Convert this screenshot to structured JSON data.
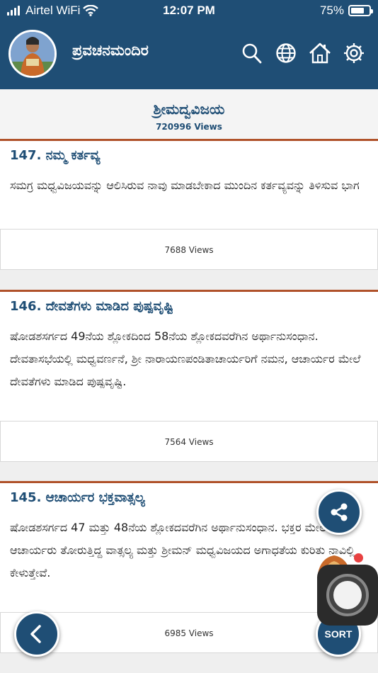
{
  "status_bar": {
    "carrier": "Airtel WiFi",
    "time": "12:07 PM",
    "battery": "75%",
    "battery_level": 0.75
  },
  "header": {
    "title": "ಪ್ರವಚನಮಂದಿರ"
  },
  "page": {
    "title": "ಶ್ರೀಮದ್ವವಿಜಯ",
    "views": "720996 Views"
  },
  "items": [
    {
      "title": "147. ನಮ್ಮ ಕರ್ತವ್ಯ",
      "desc": "ಸಮಗ್ರ ಮಧ್ವವಿಜಯವನ್ನು ಆಲಿಸಿರುವ ನಾವು ಮಾಡಬೇಕಾದ ಮುಂದಿನ ಕರ್ತವ್ಯವನ್ನು ತಿಳಿಸುವ ಭಾಗ",
      "views": "7688 Views"
    },
    {
      "title": "146. ದೇವತೆಗಳು ಮಾಡಿದ ಪುಷ್ಪವೃಷ್ಟಿ",
      "desc": "ಷೋಡಶಸರ್ಗದ 49ನೆಯ ಶ್ಲೋಕದಿಂದ 58ನೆಯ ಶ್ಲೋಕದವರೆಗಿನ ಅರ್ಥಾನುಸಂಧಾನ. ದೇವತಾಸಭೆಯಲ್ಲಿ ಮಧ್ವವರ್ಣನೆ, ಶ್ರೀ ನಾರಾಯಣಪಂಡಿತಾಚಾರ್ಯರಿಗೆ ನಮನ, ಆಚಾರ್ಯರ ಮೇಲೆ ದೇವತೆಗಳು ಮಾಡಿದ ಪುಷ್ಪವೃಷ್ಟಿ.",
      "views": "7564 Views"
    },
    {
      "title": "145. ಆಚಾರ್ಯರ ಭಕ್ತವಾತ್ಸಲ್ಯ",
      "desc": "ಷೋಡಶಸರ್ಗದ 47 ಮತ್ತು 48ನೆಯ ಶ್ಲೋಕದವರೆಗಿನ ಅರ್ಥಾನುಸಂಧಾನ. ಭಕ್ತರ ಮೇಲೆ ಆಚಾರ್ಯರು ತೋರುತ್ತಿದ್ದ ವಾತ್ಸಲ್ಯ ಮತ್ತು ಶ್ರೀಮನ್ ಮಧ್ವವಿಜಯದ ಅಗಾಧತೆಯ ಕುರಿತು ನಾವಿಲ್ಲಿ ಕೇಳುತ್ತೇವೆ.",
      "views": "6985 Views"
    }
  ],
  "controls": {
    "sort_label": "SORT"
  },
  "icons": [
    "search-icon",
    "globe-icon",
    "home-icon",
    "settings-icon",
    "share-icon",
    "back-icon"
  ],
  "colors": {
    "header_bg": "#1f4e75",
    "card_accent": "#b0522a",
    "title_text": "#1f4e75"
  }
}
